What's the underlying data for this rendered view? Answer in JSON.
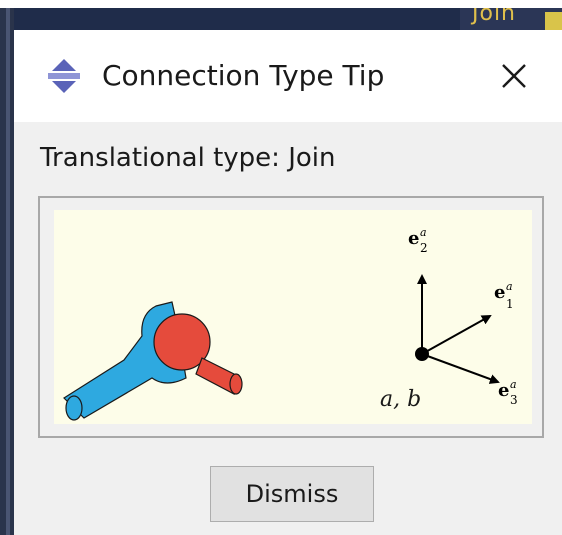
{
  "background_app": {
    "tab_text": "Join"
  },
  "dialog": {
    "title": "Connection Type Tip",
    "close_glyph": "✕",
    "heading": "Translational type: Join",
    "dismiss_label": "Dismiss",
    "icon": "connection-type-icon",
    "close_icon": "close-icon"
  },
  "figure": {
    "point_label": "a, b",
    "axes": [
      {
        "vector": "e",
        "subscript": "2",
        "superscript": "a"
      },
      {
        "vector": "e",
        "subscript": "1",
        "superscript": "a"
      },
      {
        "vector": "e",
        "subscript": "3",
        "superscript": "a"
      }
    ],
    "colors": {
      "background": "#fdfde9",
      "part_a": "#2ea9e0",
      "part_b": "#e54b3c",
      "arrow": "#000000"
    }
  }
}
